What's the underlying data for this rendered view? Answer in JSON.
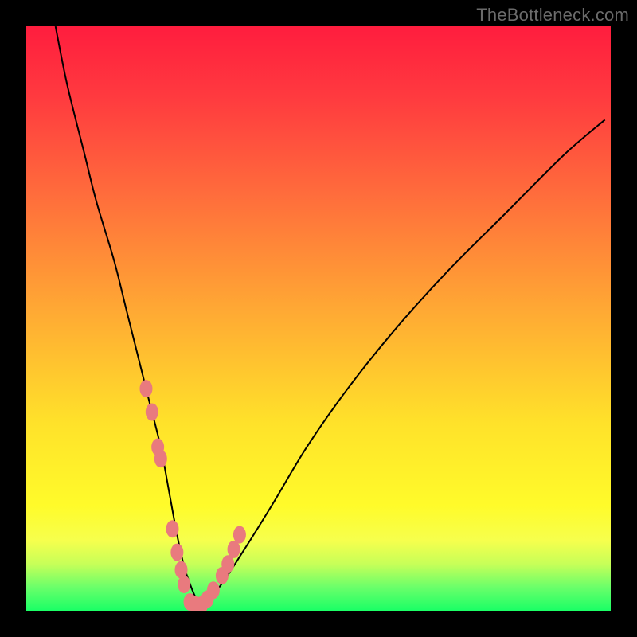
{
  "watermark": "TheBottleneck.com",
  "colors": {
    "frame": "#000000",
    "gradient_top": "#ff1d3e",
    "gradient_mid1": "#ff6a3c",
    "gradient_mid2": "#ffe22a",
    "gradient_bottom": "#1aff66",
    "curve": "#000000",
    "marker": "#e97a7e"
  },
  "chart_data": {
    "type": "line",
    "title": "",
    "xlabel": "",
    "ylabel": "",
    "xlim": [
      0,
      100
    ],
    "ylim": [
      0,
      100
    ],
    "x": [
      5,
      7,
      10,
      12,
      15,
      17,
      19,
      21,
      23,
      24.5,
      26,
      27.5,
      30,
      33,
      37,
      42,
      48,
      55,
      63,
      72,
      82,
      92,
      99
    ],
    "values": [
      100,
      90,
      78,
      70,
      60,
      52,
      44,
      36,
      28,
      20,
      12,
      6,
      1,
      4,
      10,
      18,
      28,
      38,
      48,
      58,
      68,
      78,
      84
    ],
    "markers_x": [
      20.5,
      21.5,
      22.5,
      23.0,
      25.0,
      25.8,
      26.5,
      27.0,
      28.0,
      29.0,
      30.0,
      31.0,
      32.0,
      33.5,
      34.5,
      35.5,
      36.5
    ],
    "markers_y": [
      38,
      34,
      28,
      26,
      14,
      10,
      7,
      4.5,
      1.5,
      1,
      1,
      2,
      3.5,
      6,
      8,
      10.5,
      13
    ],
    "annotations": [],
    "grid": false,
    "legend": null
  }
}
